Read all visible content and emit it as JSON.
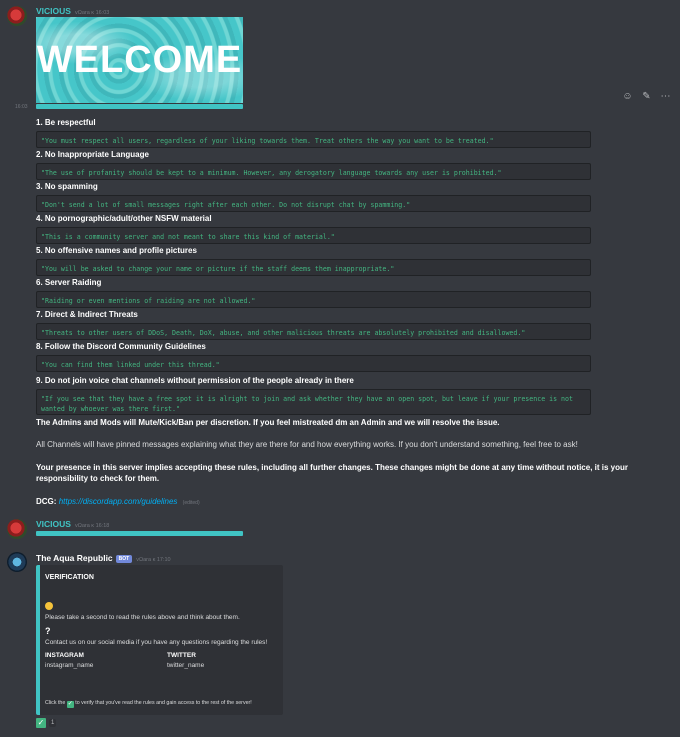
{
  "messages": {
    "first": {
      "author": "VICIOUS",
      "timestamp": "vΩara κ 16:03",
      "hover_time": "16:03",
      "welcome_text": "WELCOME",
      "rules": [
        {
          "title": "1. Be respectful",
          "quote": "\"You must respect all users, regardless of your liking towards them. Treat others the way you want to be treated.\""
        },
        {
          "title": "2. No Inappropriate Language",
          "quote": "\"The use of profanity should be kept to a minimum. However, any derogatory language towards any user is prohibited.\""
        },
        {
          "title": "3. No spamming",
          "quote": "\"Don't send a lot of small messages right after each other. Do not disrupt chat by spamming.\""
        },
        {
          "title": "4. No pornographic/adult/other NSFW material",
          "quote": "\"This is a community server and not meant to share this kind of material.\""
        },
        {
          "title": "5. No offensive names and profile pictures",
          "quote": "\"You will be asked to change your name or picture if the staff deems them inappropriate.\""
        },
        {
          "title": "6. Server Raiding",
          "quote": "\"Raiding or even mentions of raiding are not allowed.\""
        },
        {
          "title": "7. Direct & Indirect Threats",
          "quote": "\"Threats to other users of DDoS, Death, DoX, abuse, and other malicious threats are absolutely prohibited and disallowed.\""
        },
        {
          "title": "8. Follow the Discord Community Guidelines",
          "quote": "\"You can find them linked under this thread.\""
        },
        {
          "title": "9. Do not join voice chat channels without permission of the people already in there",
          "quote": "\"If you see that they have a free spot it is alright to join and ask whether they have an open spot, but leave if your presence is not wanted by whoever was there first.\""
        }
      ],
      "admins_note": "The Admins and Mods will Mute/Kick/Ban per discretion. If you feel mistreated dm an Admin and we will resolve the issue.",
      "channels_note": "All Channels will have pinned messages explaining what they are there for and how everything works. If you don't understand something, feel free to ask!",
      "presence_note": "Your presence in this server implies accepting these rules, including all further changes. These changes might be done at any time without notice, it is your responsibility to check for them.",
      "dcg_label": "DCG:",
      "dcg_link": "https://discordapp.com/guidelines",
      "edited": "(edited)"
    },
    "second": {
      "author": "VICIOUS",
      "timestamp": "vΩara κ 16:18"
    },
    "bot": {
      "author": "The Aqua Republic",
      "badge": "BOT",
      "timestamp": "vΩara κ 17:10",
      "embed": {
        "title": "VERIFICATION",
        "line1": "Please take a second to read the rules above and think about them.",
        "question": "?",
        "line2": "Contact us on our social media if you have any questions regarding the rules!",
        "instagram_label": "INSTAGRAM",
        "instagram_value": "instagram_name",
        "twitter_label": "TWITTER",
        "twitter_value": "twitter_name",
        "footer_pre": "Click the",
        "footer_post": "to verify that you've read the rules and gain access to the rest of the server!"
      },
      "reaction_count": "1"
    }
  },
  "toolbar": {
    "add_reaction_icon": "add-reaction-icon",
    "edit_icon": "edit-icon",
    "more_icon": "more-icon"
  },
  "colors": {
    "background": "#36393f",
    "accent": "#40c4c4",
    "quote_text": "#43b581",
    "link": "#00b0f4"
  }
}
